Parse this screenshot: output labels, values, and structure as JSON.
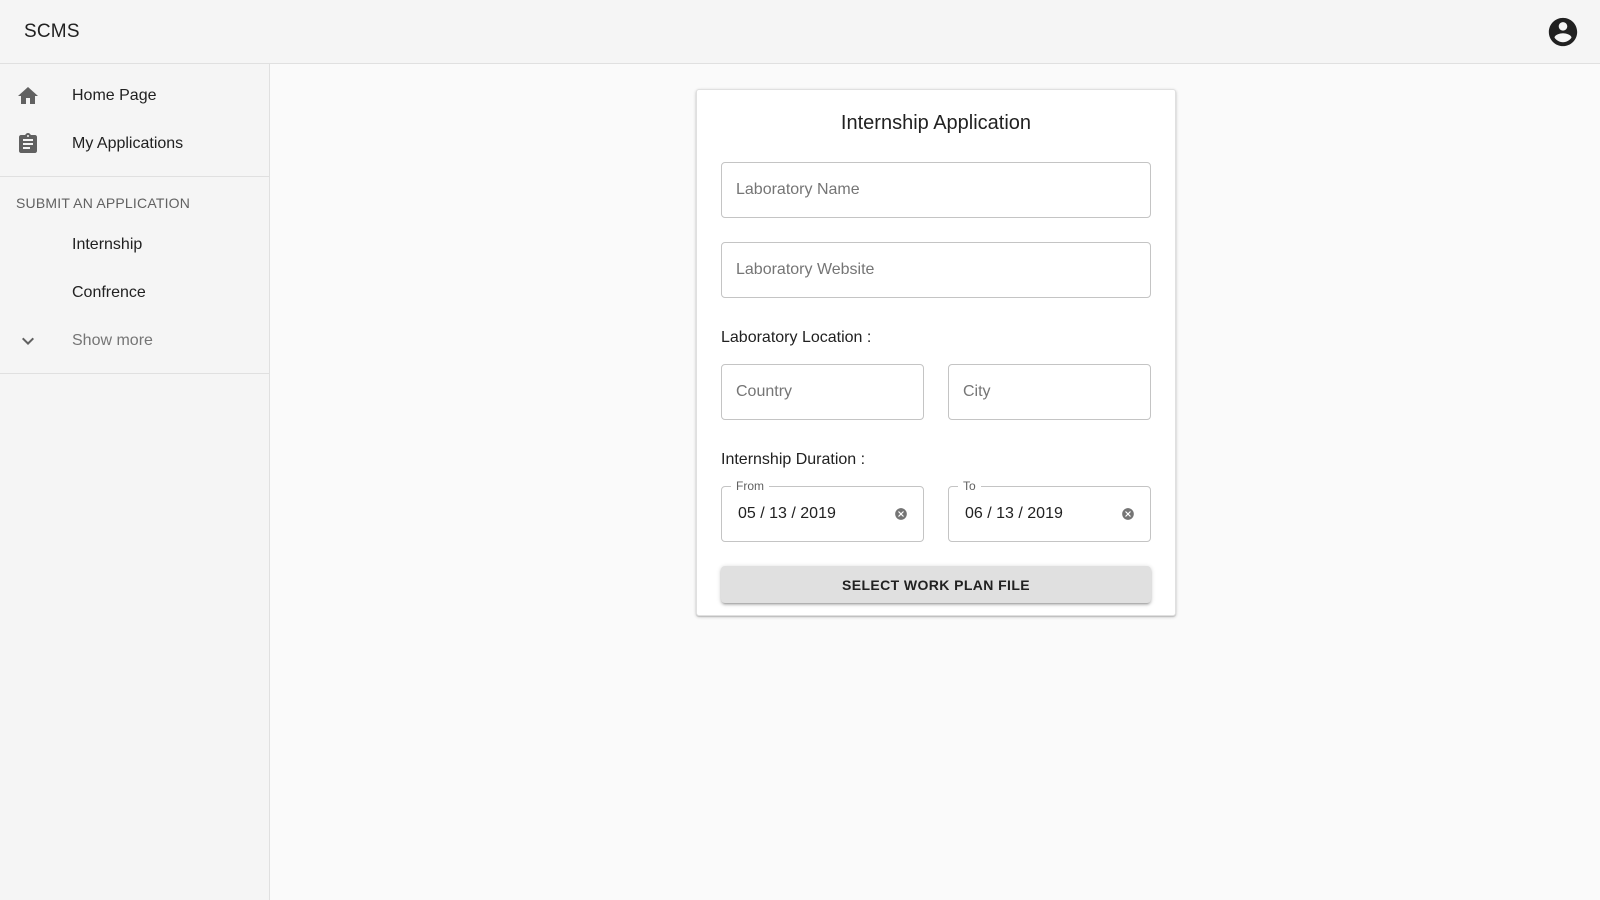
{
  "app": {
    "title": "SCMS",
    "account_icon": "account-circle-icon"
  },
  "sidebar": {
    "items": [
      {
        "label": "Home Page",
        "icon": "home-icon"
      },
      {
        "label": "My Applications",
        "icon": "assignment-icon"
      }
    ],
    "submit_header": "SUBMIT AN APPLICATION",
    "submit_items": [
      {
        "label": "Internship"
      },
      {
        "label": "Confrence"
      }
    ],
    "show_more": {
      "label": "Show more",
      "icon": "chevron-down-icon"
    }
  },
  "form": {
    "title": "Internship Application",
    "lab_name": {
      "placeholder": "Laboratory Name",
      "value": ""
    },
    "lab_website": {
      "placeholder": "Laboratory Website",
      "value": ""
    },
    "location_label": "Laboratory Location :",
    "country": {
      "placeholder": "Country",
      "value": ""
    },
    "city": {
      "placeholder": "City",
      "value": ""
    },
    "duration_label": "Internship Duration :",
    "from": {
      "label": "From",
      "value": "05 / 13 / 2019"
    },
    "to": {
      "label": "To",
      "value": "06 / 13 / 2019"
    },
    "file_button": "SELECT WORK PLAN FILE"
  },
  "colors": {
    "accent_text": "#212121",
    "muted_text": "#757575",
    "sidebar_bg": "#f5f5f5",
    "button_bg": "#e0e0e0"
  }
}
